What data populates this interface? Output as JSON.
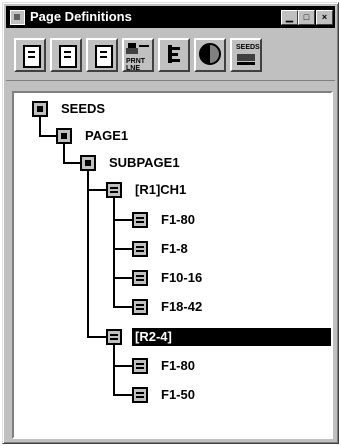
{
  "window": {
    "title": "Page Definitions",
    "controls": [
      "minimize",
      "maximize",
      "close"
    ]
  },
  "toolbar": {
    "buttons": [
      {
        "name": "new-page",
        "icon": "document-icon",
        "label": ""
      },
      {
        "name": "open-page",
        "icon": "document-icon",
        "label": ""
      },
      {
        "name": "edit-page",
        "icon": "document-edit-icon",
        "label": ""
      },
      {
        "name": "print-line",
        "icon": "printer-icon",
        "label": "PRNT LNE"
      },
      {
        "name": "text-block",
        "icon": "text-block-icon",
        "label": ""
      },
      {
        "name": "shade",
        "icon": "half-circle-icon",
        "label": ""
      },
      {
        "name": "seeds",
        "icon": "seeds-icon",
        "label": "SEEDS"
      }
    ]
  },
  "tree": {
    "nodes": [
      {
        "label": "SEEDS",
        "level": 0,
        "selected": false
      },
      {
        "label": "PAGE1",
        "level": 1,
        "selected": false
      },
      {
        "label": "SUBPAGE1",
        "level": 2,
        "selected": false
      },
      {
        "label": "[R1]CH1",
        "level": 3,
        "selected": false
      },
      {
        "label": "F1-80",
        "level": 4,
        "selected": false
      },
      {
        "label": "F1-8",
        "level": 4,
        "selected": false
      },
      {
        "label": "F10-16",
        "level": 4,
        "selected": false
      },
      {
        "label": "F18-42",
        "level": 4,
        "selected": false
      },
      {
        "label": "[R2-4]",
        "level": 3,
        "selected": true
      },
      {
        "label": "F1-80",
        "level": 4,
        "selected": false
      },
      {
        "label": "F1-50",
        "level": 4,
        "selected": false
      }
    ]
  }
}
